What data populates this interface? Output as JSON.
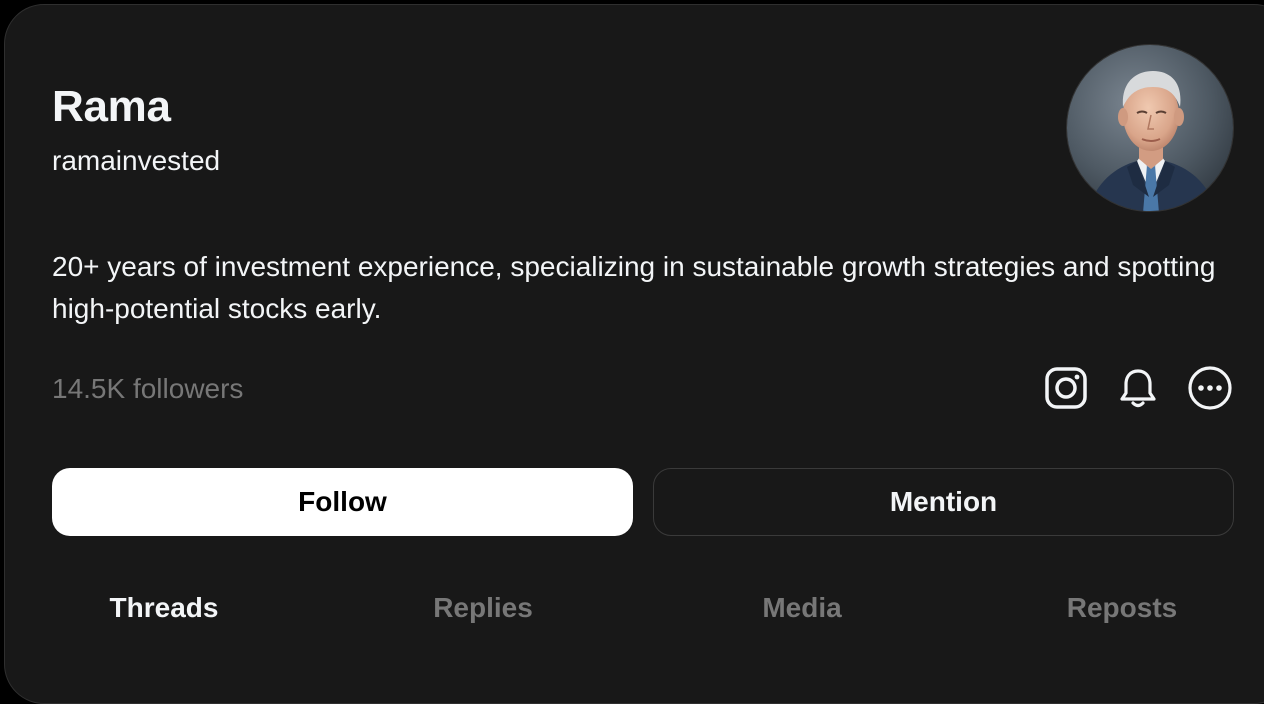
{
  "profile": {
    "name": "Rama",
    "username": "ramainvested",
    "bio": "20+ years of investment experience, specializing in sustainable growth strategies and spotting high-potential stocks early.",
    "followers": "14.5K followers"
  },
  "icons": {
    "instagram": "instagram-icon",
    "notifications": "bell-icon",
    "more": "more-options-icon"
  },
  "actions": {
    "follow_label": "Follow",
    "mention_label": "Mention"
  },
  "tabs": [
    {
      "label": "Threads",
      "active": true
    },
    {
      "label": "Replies",
      "active": false
    },
    {
      "label": "Media",
      "active": false
    },
    {
      "label": "Reposts",
      "active": false
    }
  ],
  "colors": {
    "background": "#181818",
    "text_primary": "#f3f5f7",
    "text_secondary": "#777777",
    "follow_button": "#ffffff"
  }
}
